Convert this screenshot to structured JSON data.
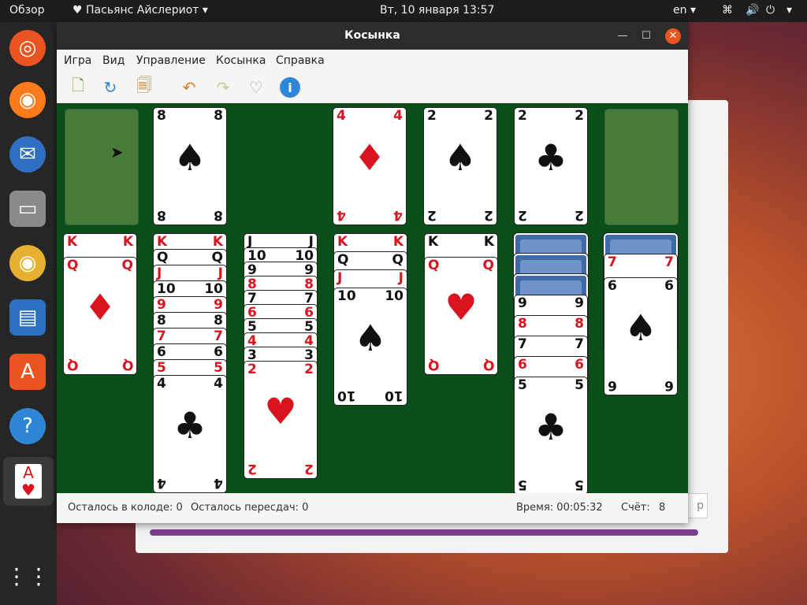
{
  "topbar": {
    "overview": "Обзор",
    "app_name": "Пасьянс Айслериот",
    "clock": "Вт, 10 января  13:57",
    "lang": "en"
  },
  "window": {
    "title": "Косынка",
    "menu": [
      "Игра",
      "Вид",
      "Управление",
      "Косынка",
      "Справка"
    ]
  },
  "status": {
    "deck_left": "Осталось в колоде: 0",
    "redeals_left": "Осталось пересдач: 0",
    "time": "Время: 00:05:32",
    "score_label": "Счёт:",
    "score": "8"
  },
  "foundations": [
    {
      "rank": "8",
      "suit": "♠"
    },
    {
      "rank": "4",
      "suit": "♦"
    },
    {
      "rank": "2",
      "suit": "♠"
    },
    {
      "rank": "2",
      "suit": "♣"
    }
  ],
  "tableau": [
    [
      "K♦",
      "Q♦"
    ],
    [
      "K♥",
      "Q♠",
      "J♥",
      "10♠",
      "9♥",
      "8♠",
      "7♥",
      "6♠",
      "5♥",
      "4♣"
    ],
    [
      "J♠",
      "10♠",
      "9♠",
      "8♦",
      "7♠",
      "6♦",
      "5♠",
      "4♦",
      "3♠",
      "2♥"
    ],
    [
      "K♥",
      "Q♠",
      "J♥",
      "10♠"
    ],
    [
      "K♠",
      "Q♥"
    ],
    [
      "9♠",
      "8♥",
      "7♣",
      "6♥",
      "5♣"
    ],
    [
      "7♦",
      "6♠"
    ]
  ],
  "backwin": {
    "field_text": "р"
  }
}
